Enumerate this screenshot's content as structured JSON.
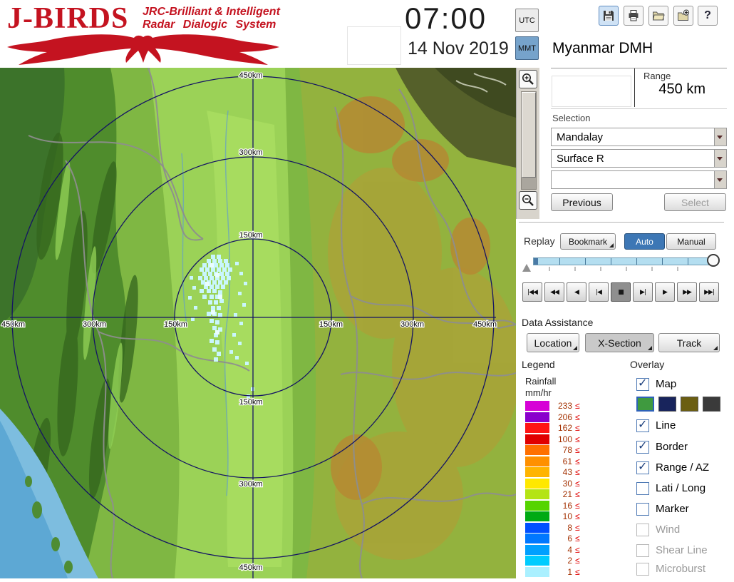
{
  "header": {
    "logo": {
      "title": "J-BIRDS",
      "tagline1": "JRC-Brilliant & Intelligent",
      "tagline2": "Radar Dialogic System"
    },
    "clock": {
      "time": "07:00",
      "date": "14 Nov 2019"
    },
    "timezone": {
      "utc": "UTC",
      "mmt": "MMT",
      "active": "MMT"
    },
    "toolbar": {
      "icons": [
        "save",
        "print",
        "open-folder",
        "export",
        "help"
      ],
      "help_glyph": "?"
    },
    "station": "Myanmar DMH"
  },
  "range_panel": {
    "label": "Range",
    "value": "450 km"
  },
  "selection": {
    "label": "Selection",
    "dropdowns": [
      "Mandalay",
      "Surface R",
      ""
    ],
    "previous": "Previous",
    "select": "Select"
  },
  "replay": {
    "label": "Replay",
    "bookmark": "Bookmark",
    "auto": "Auto",
    "manual": "Manual",
    "playback": [
      "|◀◀",
      "◀◀",
      "◀",
      "|◀",
      "■",
      "▶|",
      "▶",
      "▶▶",
      "▶▶|"
    ]
  },
  "data_assistance": {
    "label": "Data Assistance",
    "buttons": [
      "Location",
      "X-Section",
      "Track"
    ]
  },
  "legend": {
    "label": "Legend",
    "unit1": "Rainfall",
    "unit2": "mm/hr",
    "le": "≤",
    "entries": [
      {
        "v": "233",
        "c": "#d602d6"
      },
      {
        "v": "206",
        "c": "#8a00cc"
      },
      {
        "v": "162",
        "c": "#ff1414"
      },
      {
        "v": "100",
        "c": "#e00000"
      },
      {
        "v": "78",
        "c": "#ff7000"
      },
      {
        "v": "61",
        "c": "#ff9000"
      },
      {
        "v": "43",
        "c": "#ffb400"
      },
      {
        "v": "30",
        "c": "#ffe800"
      },
      {
        "v": "21",
        "c": "#b4e414"
      },
      {
        "v": "16",
        "c": "#55d400"
      },
      {
        "v": "10",
        "c": "#00aa14"
      },
      {
        "v": "8",
        "c": "#0050ff"
      },
      {
        "v": "6",
        "c": "#0078ff"
      },
      {
        "v": "4",
        "c": "#00a0ff"
      },
      {
        "v": "2",
        "c": "#00ccff"
      },
      {
        "v": "1",
        "c": "#aaf0ff"
      }
    ]
  },
  "overlay": {
    "label": "Overlay",
    "check_glyph": "✓",
    "map_styles": [
      "#3f9a3f",
      "#18245c",
      "#6b5e12",
      "#3a3a3a"
    ],
    "items": [
      {
        "label": "Map",
        "checked": true,
        "enabled": true
      },
      {
        "label": "Line",
        "checked": true,
        "enabled": true
      },
      {
        "label": "Border",
        "checked": true,
        "enabled": true
      },
      {
        "label": "Range / AZ",
        "checked": true,
        "enabled": true
      },
      {
        "label": "Lati / Long",
        "checked": false,
        "enabled": true
      },
      {
        "label": "Marker",
        "checked": false,
        "enabled": true
      },
      {
        "label": "Wind",
        "checked": false,
        "enabled": false
      },
      {
        "label": "Shear Line",
        "checked": false,
        "enabled": false
      },
      {
        "label": "Microburst",
        "checked": false,
        "enabled": false
      }
    ]
  },
  "map": {
    "rings": [
      "450km",
      "300km",
      "150km",
      "150km",
      "300km",
      "450km",
      "450km",
      "300km",
      "150km",
      "150km",
      "300km",
      "450km"
    ]
  }
}
